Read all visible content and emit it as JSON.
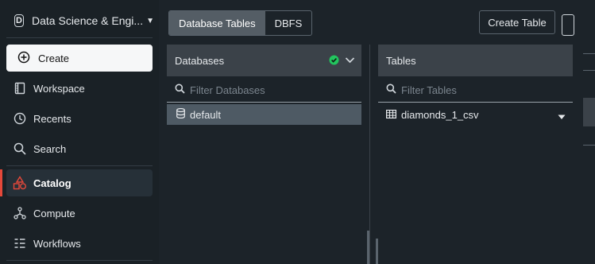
{
  "sidebar": {
    "workspace_initial": "D",
    "workspace_name": "Data Science & Engi...",
    "create_label": "Create",
    "items": [
      {
        "label": "Workspace",
        "icon": "workspace-icon"
      },
      {
        "label": "Recents",
        "icon": "clock-icon"
      },
      {
        "label": "Search",
        "icon": "search-icon"
      },
      {
        "label": "Catalog",
        "icon": "catalog-icon",
        "active": true
      },
      {
        "label": "Compute",
        "icon": "compute-icon"
      },
      {
        "label": "Workflows",
        "icon": "workflows-icon"
      }
    ],
    "accent_color": "#e5483a"
  },
  "toolbar": {
    "tabs": [
      "Database Tables",
      "DBFS"
    ],
    "selected_tab": "Database Tables",
    "create_table_label": "Create Table"
  },
  "databases_panel": {
    "title": "Databases",
    "filter_placeholder": "Filter Databases",
    "items": [
      "default"
    ],
    "selected": "default",
    "status_color": "#22c55e"
  },
  "tables_panel": {
    "title": "Tables",
    "filter_placeholder": "Filter Tables",
    "items": [
      "diamonds_1_csv"
    ]
  }
}
